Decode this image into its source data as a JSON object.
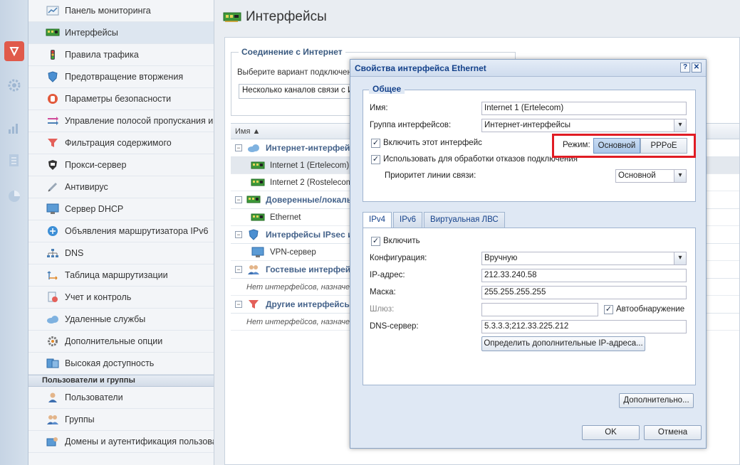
{
  "sidebar": {
    "items": [
      {
        "label": "Панель мониторинга",
        "icon": "dashboard-icon"
      },
      {
        "label": "Интерфейсы",
        "icon": "network-card-icon",
        "active": true
      },
      {
        "label": "Правила трафика",
        "icon": "traffic-light-icon"
      },
      {
        "label": "Предотвращение вторжения",
        "icon": "shield-icon"
      },
      {
        "label": "Параметры безопасности",
        "icon": "hand-icon"
      },
      {
        "label": "Управление полосой пропускания и",
        "icon": "arrows-icon"
      },
      {
        "label": "Фильтрация содержимого",
        "icon": "filter-icon"
      },
      {
        "label": "Прокси-сервер",
        "icon": "proxy-shield-icon"
      },
      {
        "label": "Антивирус",
        "icon": "syringe-icon"
      },
      {
        "label": "Сервер DHCP",
        "icon": "monitor-icon"
      },
      {
        "label": "Объявления маршрутизатора IPv6",
        "icon": "router-icon"
      },
      {
        "label": "DNS",
        "icon": "dns-tree-icon"
      },
      {
        "label": "Таблица маршрутизации",
        "icon": "routing-table-icon"
      },
      {
        "label": "Учет и контроль",
        "icon": "accounting-icon"
      },
      {
        "label": "Удаленные службы",
        "icon": "cloud-icon"
      },
      {
        "label": "Дополнительные опции",
        "icon": "options-gear-icon"
      },
      {
        "label": "Высокая доступность",
        "icon": "servers-icon"
      }
    ],
    "section_users": "Пользователи и группы",
    "user_items": [
      {
        "label": "Пользователи",
        "icon": "user-icon"
      },
      {
        "label": "Группы",
        "icon": "group-icon"
      },
      {
        "label": "Домены и аутентификация пользова",
        "icon": "domain-icon"
      }
    ]
  },
  "page": {
    "title": "Интерфейсы"
  },
  "connection": {
    "legend": "Соединение с Интернет",
    "prompt": "Выберите вариант подключени",
    "select_value": "Несколько каналов связи с Инт"
  },
  "grid": {
    "column_name": "Имя ▲",
    "groups": [
      {
        "label": "Интернет-интерфейсы",
        "rows": [
          "Internet 1 (Ertelecom)",
          "Internet 2 (Rostelecom)"
        ],
        "empty": ""
      },
      {
        "label": "Доверенные/локальные",
        "rows": [
          "Ethernet"
        ],
        "empty": ""
      },
      {
        "label": "Интерфейсы IPsec и Ke",
        "rows": [
          "VPN-сервер"
        ],
        "empty": ""
      },
      {
        "label": "Гостевые интерфейсы",
        "rows": [],
        "empty": "Нет интерфейсов, назначенн"
      },
      {
        "label": "Другие интерфейсы",
        "rows": [],
        "empty": "Нет интерфейсов, назначенн"
      }
    ]
  },
  "dialog": {
    "title": "Свойства интерфейса Ethernet",
    "help": "?",
    "close": "✕",
    "general": {
      "legend": "Общее",
      "name_label": "Имя:",
      "name_value": "Internet 1 (Ertelecom)",
      "group_label": "Группа интерфейсов:",
      "group_value": "Интернет-интерфейсы",
      "enable_label": "Включить этот интерфейс",
      "failover_label": "Использовать для обработки отказов подключения",
      "priority_label": "Приоритет линии связи:",
      "priority_value": "Основной",
      "mode_label": "Режим:",
      "mode_main": "Основной",
      "mode_pppoe": "PPPoE"
    },
    "tabs": [
      "IPv4",
      "IPv6",
      "Виртуальная ЛВС"
    ],
    "ipv4": {
      "enable_label": "Включить",
      "config_label": "Конфигурация:",
      "config_value": "Вручную",
      "ip_label": "IP-адрес:",
      "ip_value": "212.33.240.58",
      "mask_label": "Маска:",
      "mask_value": "255.255.255.255",
      "gateway_label": "Шлюз:",
      "gateway_value": "",
      "autodetect_label": "Автообнаружение",
      "dns_label": "DNS-сервер:",
      "dns_value": "5.3.3.3;212.33.225.212",
      "extra_ip_button": "Определить дополнительные IP-адреса..."
    },
    "advanced_button": "Дополнительно...",
    "ok_button": "OK",
    "cancel_button": "Отмена",
    "check_mark": "✓"
  },
  "colors": {
    "accent": "#15428b",
    "highlight_box": "#e01c24",
    "rail_shield": "#e05a4b"
  }
}
